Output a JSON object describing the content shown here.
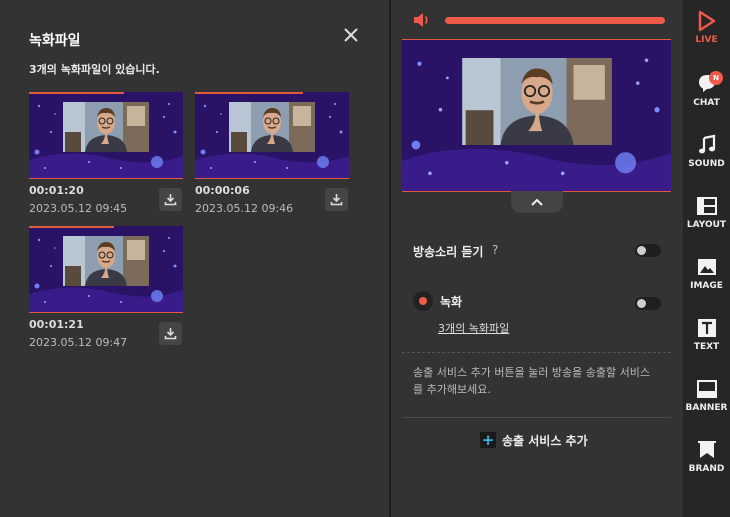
{
  "recordings_panel": {
    "title": "녹화파일",
    "subtitle": "3개의 녹화파일이 있습니다.",
    "items": [
      {
        "duration": "00:01:20",
        "date": "2023.05.12 09:45"
      },
      {
        "duration": "00:00:06",
        "date": "2023.05.12 09:46"
      },
      {
        "duration": "00:01:21",
        "date": "2023.05.12 09:47"
      }
    ]
  },
  "studio": {
    "volume_level": 1.0,
    "listen_label": "방송소리 듣기",
    "listen_help": "?",
    "record_label": "녹화",
    "record_files_link": "3개의 녹화파일",
    "info_text": "송출 서비스 추가 버튼을 눌러 방송을 송출할 서비스를 추가해보세요.",
    "add_service_label": "송출 서비스 추가",
    "accent_color": "#f05a4a",
    "plus_color": "#39b4e6"
  },
  "rail": {
    "items": [
      {
        "label": "LIVE",
        "icon": "play-icon",
        "active": true
      },
      {
        "label": "CHAT",
        "icon": "chat-icon",
        "badge": "N"
      },
      {
        "label": "SOUND",
        "icon": "music-note-icon"
      },
      {
        "label": "LAYOUT",
        "icon": "layout-icon"
      },
      {
        "label": "IMAGE",
        "icon": "image-icon"
      },
      {
        "label": "TEXT",
        "icon": "text-icon"
      },
      {
        "label": "BANNER",
        "icon": "banner-icon"
      },
      {
        "label": "BRAND",
        "icon": "brand-icon"
      }
    ]
  }
}
